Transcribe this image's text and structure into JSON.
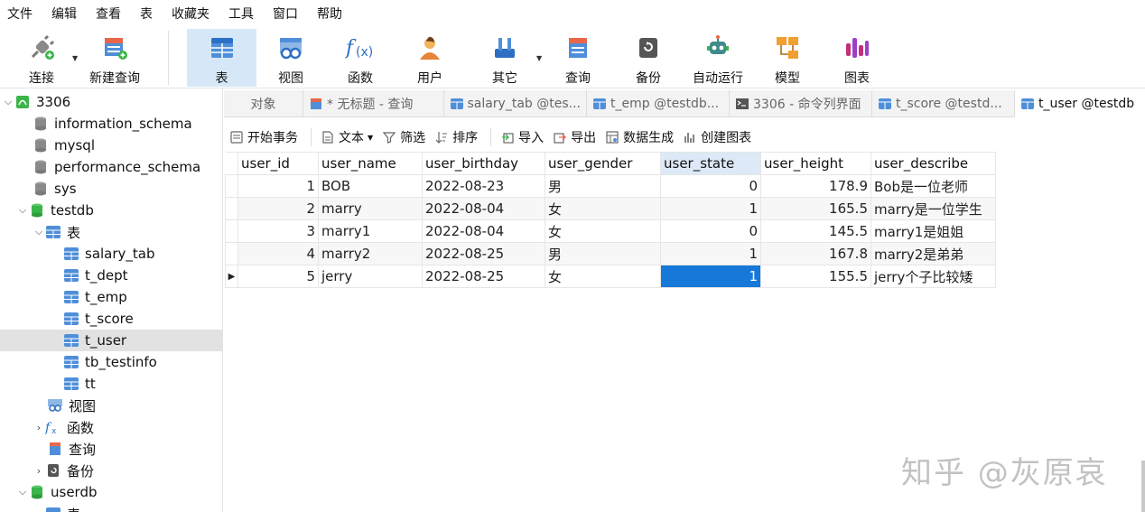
{
  "menu": [
    "文件",
    "编辑",
    "查看",
    "表",
    "收藏夹",
    "工具",
    "窗口",
    "帮助"
  ],
  "toolbar": {
    "connect": "连接",
    "new_query": "新建查询",
    "table": "表",
    "view": "视图",
    "function": "函数",
    "user": "用户",
    "other": "其它",
    "query": "查询",
    "backup": "备份",
    "auto_run": "自动运行",
    "model": "模型",
    "chart": "图表"
  },
  "tree": {
    "root": "3306",
    "dbs": [
      "information_schema",
      "mysql",
      "performance_schema",
      "sys"
    ],
    "testdb": "testdb",
    "tables_node": "表",
    "tables": [
      "salary_tab",
      "t_dept",
      "t_emp",
      "t_score",
      "t_user",
      "tb_testinfo",
      "tt"
    ],
    "view_node": "视图",
    "func_node": "函数",
    "query_node": "查询",
    "backup_node": "备份",
    "userdb": "userdb",
    "userdb_tables": "表"
  },
  "tabs": [
    "对象",
    "* 无标题 - 查询",
    "salary_tab @tes...",
    "t_emp @testdb...",
    "3306 - 命令列界面",
    "t_score @testd...",
    "t_user @testdb"
  ],
  "subtoolbar": {
    "begin_tx": "开始事务",
    "text": "文本",
    "filter": "筛选",
    "sort": "排序",
    "import": "导入",
    "export": "导出",
    "data_gen": "数据生成",
    "create_chart": "创建图表"
  },
  "grid": {
    "columns": [
      "user_id",
      "user_name",
      "user_birthday",
      "user_gender",
      "user_state",
      "user_height",
      "user_describe"
    ],
    "rows": [
      [
        "1",
        "BOB",
        "2022-08-23",
        "男",
        "0",
        "178.9",
        "Bob是一位老师"
      ],
      [
        "2",
        "marry",
        "2022-08-04",
        "女",
        "1",
        "165.5",
        "marry是一位学生"
      ],
      [
        "3",
        "marry1",
        "2022-08-04",
        "女",
        "0",
        "145.5",
        "marry1是姐姐"
      ],
      [
        "4",
        "marry2",
        "2022-08-25",
        "男",
        "1",
        "167.8",
        "marry2是弟弟"
      ],
      [
        "5",
        "jerry",
        "2022-08-25",
        "女",
        "1",
        "155.5",
        "jerry个子比较矮"
      ]
    ]
  },
  "watermark": "知乎 @灰原哀",
  "colors": {
    "selection": "#1678d8",
    "active_tool": "#d6e8f7",
    "sorted_col": "#dde9f6"
  }
}
